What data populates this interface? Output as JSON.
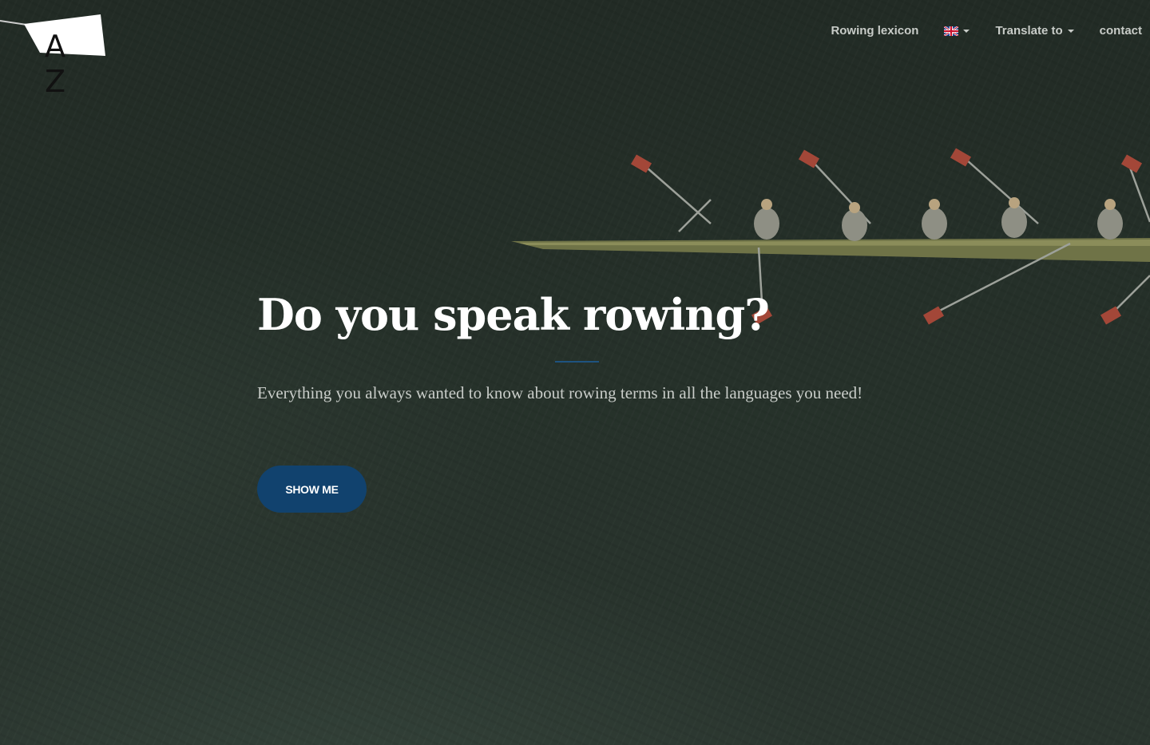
{
  "logo": {
    "text": "A Z"
  },
  "nav": {
    "lexicon_label": "Rowing lexicon",
    "language": {
      "flag_icon": "uk-flag-icon",
      "selected": "English"
    },
    "translate_label": "Translate to",
    "contact_label": "contact"
  },
  "hero": {
    "title": "Do you speak rowing?",
    "subtitle": "Everything you always wanted to know about rowing terms in all the languages you need!",
    "cta_label": "SHOW ME"
  },
  "colors": {
    "background": "#253028",
    "accent": "#11426e",
    "divider": "#1e5380",
    "nav_text": "#c8ccc8"
  }
}
